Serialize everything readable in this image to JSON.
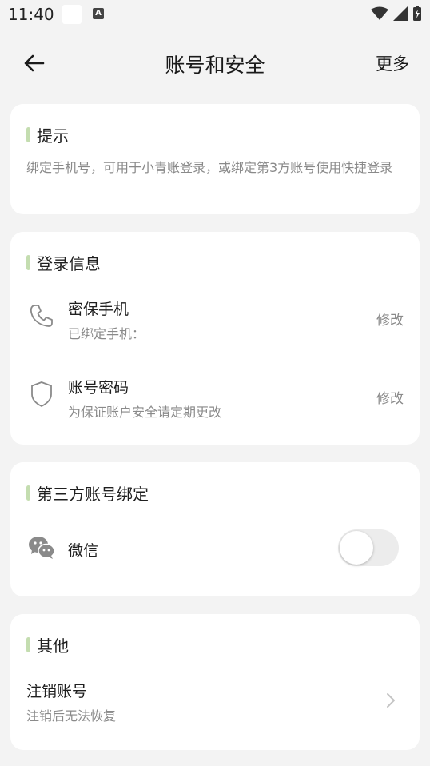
{
  "status_bar": {
    "time": "11:40",
    "notif_letter": "A"
  },
  "header": {
    "title": "账号和安全",
    "more_label": "更多"
  },
  "hint_card": {
    "title": "提示",
    "text": "绑定手机号，可用于小青账登录，或绑定第3方账号使用快捷登录"
  },
  "login_card": {
    "title": "登录信息",
    "items": [
      {
        "title": "密保手机",
        "subtitle": "已绑定手机：",
        "action": "修改",
        "icon": "phone-icon"
      },
      {
        "title": "账号密码",
        "subtitle": "为保证账户安全请定期更改",
        "action": "修改",
        "icon": "shield-icon"
      }
    ]
  },
  "third_party_card": {
    "title": "第三方账号绑定",
    "items": [
      {
        "label": "微信",
        "icon": "wechat-icon",
        "toggle_on": false
      }
    ]
  },
  "other_card": {
    "title": "其他",
    "items": [
      {
        "title": "注销账号",
        "subtitle": "注销后无法恢复",
        "icon": "chevron-right-icon"
      }
    ]
  },
  "colors": {
    "accent_bar": "#c4ddb0",
    "background": "#f3f3f3",
    "card": "#ffffff",
    "secondary_text": "#8a8a8a"
  }
}
